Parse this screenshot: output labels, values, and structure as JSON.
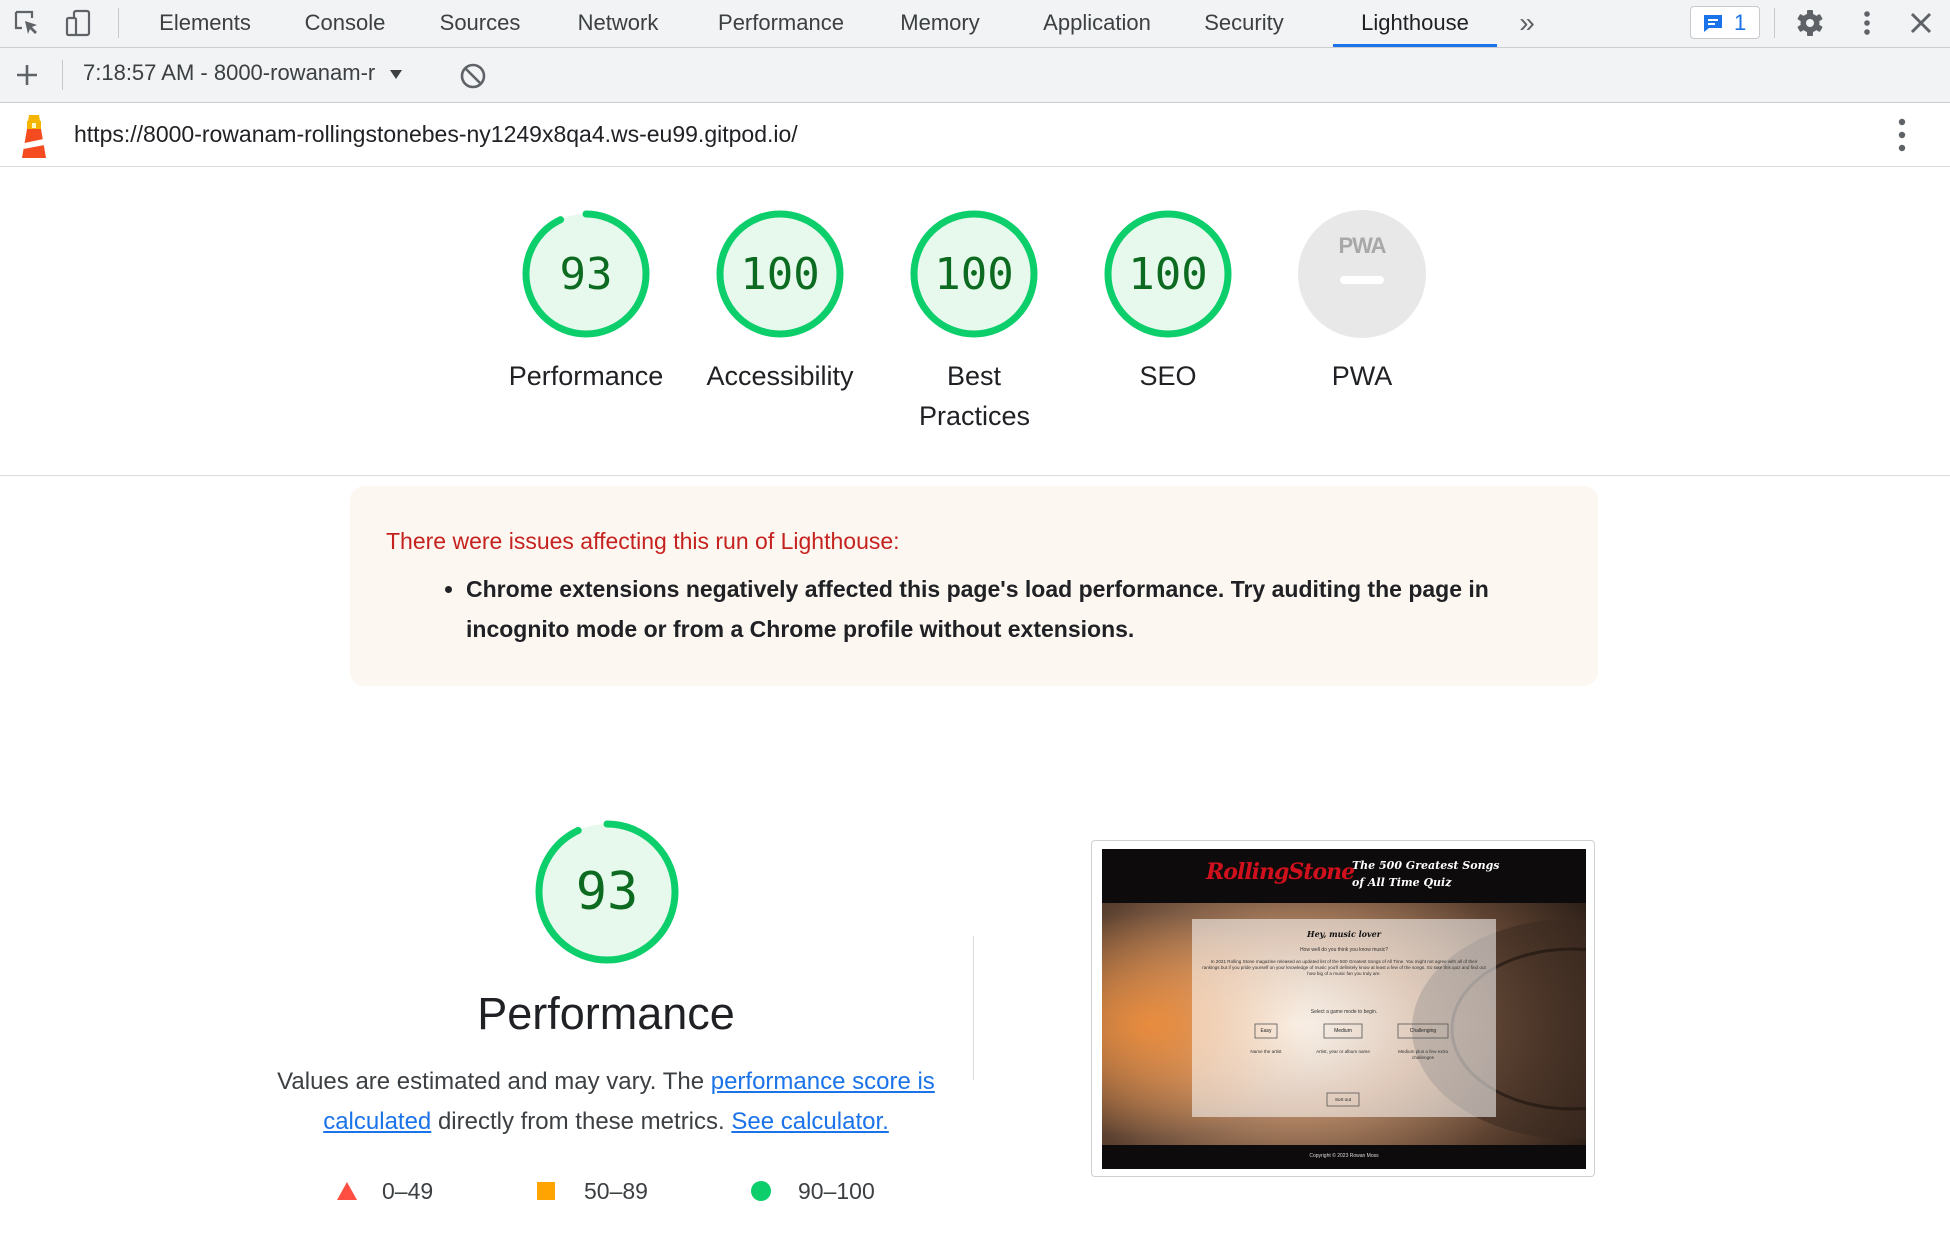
{
  "devtools": {
    "tabs": [
      "Elements",
      "Console",
      "Sources",
      "Network",
      "Performance",
      "Memory",
      "Application",
      "Security",
      "Lighthouse"
    ],
    "active_tab": "Lighthouse",
    "more_tabs": "»",
    "issues_count": "1"
  },
  "toolbar": {
    "report_label": "7:18:57 AM - 8000-rowanam-r"
  },
  "report": {
    "url": "https://8000-rowanam-rollingstonebes-ny1249x8qa4.ws-eu99.gitpod.io/"
  },
  "gauges": [
    {
      "label": "Performance",
      "score": "93",
      "value": 93
    },
    {
      "label": "Accessibility",
      "score": "100",
      "value": 100
    },
    {
      "label": "Best Practices",
      "score": "100",
      "value": 100
    },
    {
      "label": "SEO",
      "score": "100",
      "value": 100
    },
    {
      "label": "PWA",
      "score": "PWA",
      "value": null
    }
  ],
  "warning": {
    "title": "There were issues affecting this run of Lighthouse:",
    "items": [
      "Chrome extensions negatively affected this page's load performance. Try auditing the page in incognito mode or from a Chrome profile without extensions."
    ]
  },
  "performance": {
    "score": "93",
    "value": 93,
    "title": "Performance",
    "desc_prefix": "Values are estimated and may vary. The ",
    "link1": "performance score is calculated",
    "desc_middle": " directly from these metrics. ",
    "link2": "See calculator.",
    "legend": [
      "0–49",
      "50–89",
      "90–100"
    ]
  },
  "screenshot": {
    "brand": "RollingStone",
    "heading_line1": "The 500 Greatest Songs",
    "heading_line2": "of All Time Quiz",
    "card_title": "Hey, music lover",
    "card_sub": "How well do you think you know music?",
    "card_body": "In 2021 Rolling Stone magazine released an updated list of the 500 Greatest Songs of All Time. You might not agree with all of their rankings but if you pride yourself on your knowledge of music you'll definitely know at least a few of the songs. So take this quiz and find out how big of a music fan you truly are.",
    "select_mode": "Select a game mode to begin.",
    "modes": [
      "Easy",
      "Medium",
      "Challenging"
    ],
    "mode_desc": [
      "Name the artist",
      "Artist, year or album name",
      "Medium plus a few extra challenges"
    ],
    "sort_button": "Sort out",
    "footer": "Copyright © 2023 Rowan Moss"
  },
  "colors": {
    "pass": "#0cce6b",
    "pass_text": "#0c6b20",
    "pass_bg": "#e6f9ec",
    "average": "#ffa400",
    "fail": "#ff4e42",
    "link": "#1a73e8",
    "accent": "#1a73e8"
  }
}
